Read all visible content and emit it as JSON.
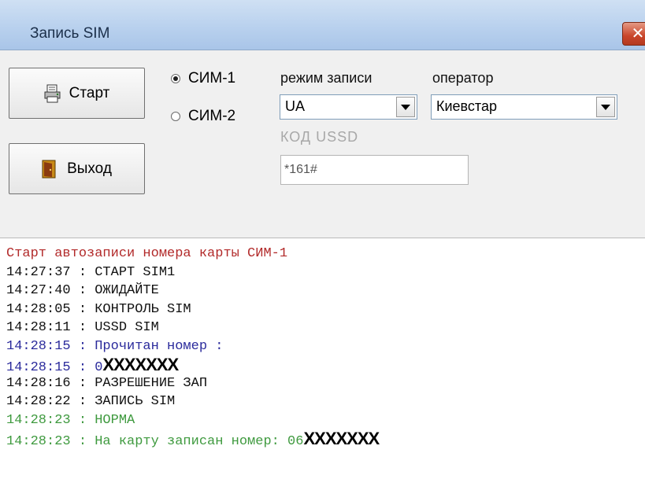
{
  "window": {
    "title": "Запись SIM",
    "close_glyph": "✕"
  },
  "buttons": {
    "start_label": "Старт",
    "exit_label": "Выход"
  },
  "sim": {
    "sim1_label": "СИМ-1",
    "sim2_label": "СИМ-2",
    "selected": "СИМ-1"
  },
  "mode": {
    "label": "режим записи",
    "value": "UA"
  },
  "operator": {
    "label": "оператор",
    "value": "Киевстар"
  },
  "ussd": {
    "label": "КОД USSD",
    "value": "*161#"
  },
  "log": {
    "lines": [
      {
        "text": "Старт автозаписи номера карты СИМ-1",
        "color": "#b22a2a"
      },
      {
        "text": "14:27:37 : СТАРТ SIM1",
        "color": "#111111"
      },
      {
        "text": "14:27:40 : ОЖИДАЙТЕ",
        "color": "#111111"
      },
      {
        "text": "14:28:05 : КОНТРОЛЬ SIM",
        "color": "#111111"
      },
      {
        "text": "14:28:11 : USSD SIM",
        "color": "#111111"
      },
      {
        "text": "14:28:15 : Прочитан номер :",
        "color": "#2b2b9c"
      },
      {
        "text": "14:28:15 : 0",
        "redacted": "XXXXXXX",
        "color": "#2b2b9c"
      },
      {
        "text": "14:28:16 : РАЗРЕШЕНИЕ ЗАП",
        "color": "#111111"
      },
      {
        "text": "14:28:22 : ЗАПИСЬ SIM",
        "color": "#111111"
      },
      {
        "text": "14:28:23 : НОРМА",
        "color": "#3f9a3f"
      },
      {
        "text": "14:28:23 : На карту записан номер: 06",
        "redacted": "XXXXXXX",
        "color": "#3f9a3f"
      }
    ]
  },
  "icons": {
    "start": "printer-icon",
    "exit": "door-exit-icon",
    "close": "close-icon",
    "dropdown": "chevron-down-icon"
  }
}
